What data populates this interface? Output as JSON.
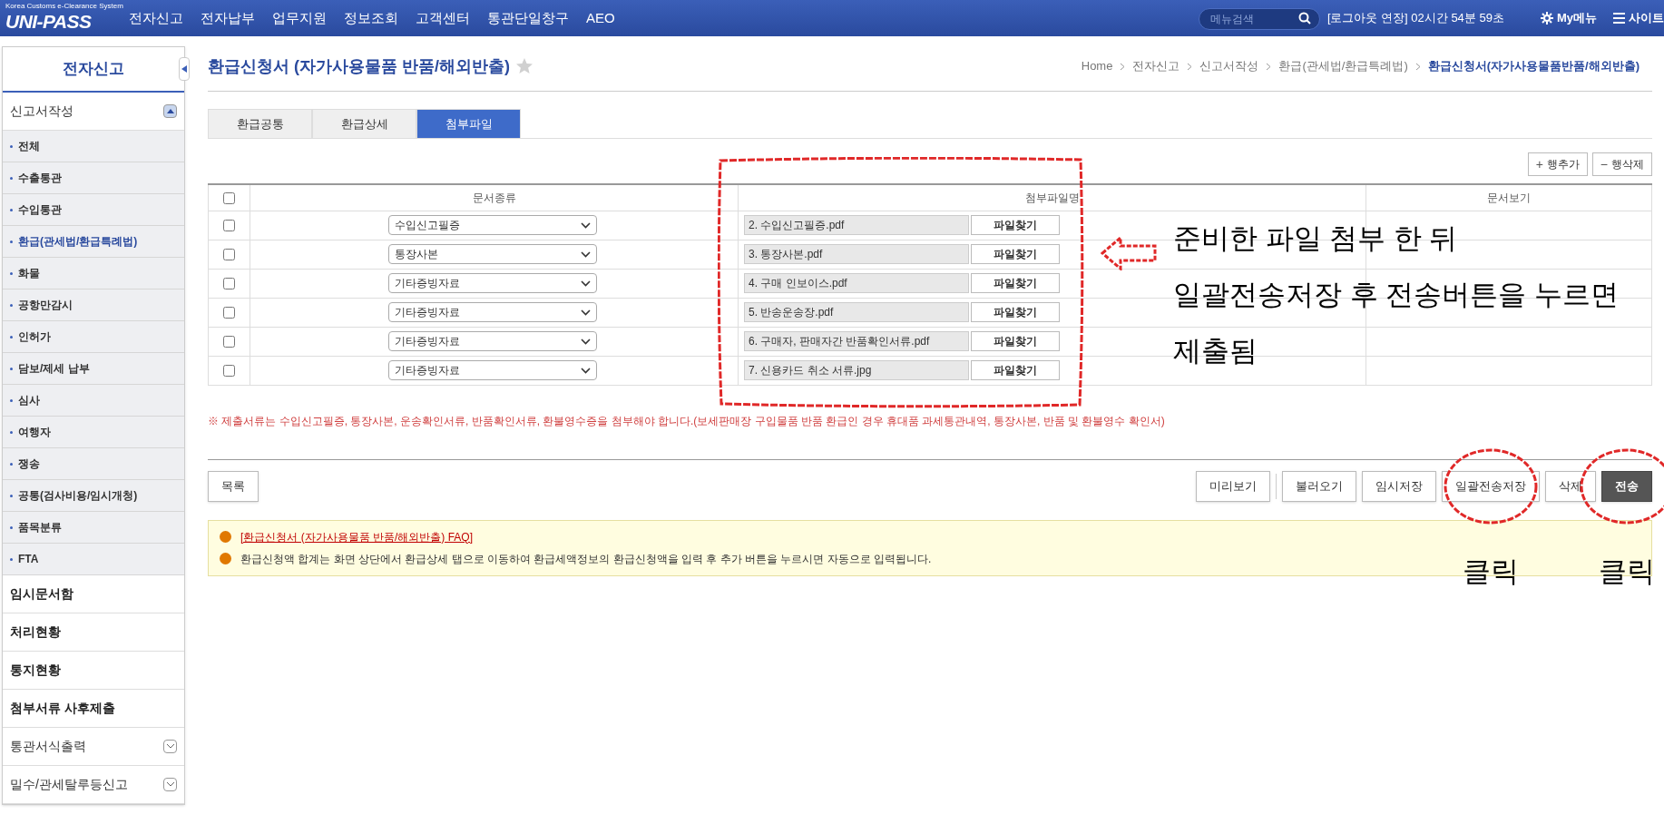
{
  "top_bar": {
    "logo": "UNI-PASS",
    "logo_subtitle": "Korea Customs e-Clearance System",
    "menu": [
      "전자신고",
      "전자납부",
      "업무지원",
      "정보조회",
      "고객센터",
      "통관단일창구",
      "AEO"
    ],
    "search": {
      "placeholder": "메뉴검색"
    },
    "session": "[로그아웃 연장] 02시간 54분 59초",
    "my_menu": "My메뉴",
    "sitemap": "사이트"
  },
  "sidebar": {
    "title": "전자신고",
    "items": [
      {
        "label": "신고서작성",
        "kind": "group",
        "expanded": true,
        "children": [
          {
            "label": "전체",
            "selected": false
          },
          {
            "label": "수출통관",
            "selected": false
          },
          {
            "label": "수입통관",
            "selected": false
          },
          {
            "label": "환급(관세법/환급특례법)",
            "selected": true
          },
          {
            "label": "화물",
            "selected": false
          },
          {
            "label": "공항만감시",
            "selected": false
          },
          {
            "label": "인허가",
            "selected": false
          },
          {
            "label": "담보/제세 납부",
            "selected": false
          },
          {
            "label": "심사",
            "selected": false
          },
          {
            "label": "여행자",
            "selected": false
          },
          {
            "label": "쟁송",
            "selected": false
          },
          {
            "label": "공통(검사비용/임시개청)",
            "selected": false
          },
          {
            "label": "품목분류",
            "selected": false
          },
          {
            "label": "FTA",
            "selected": false
          }
        ]
      },
      {
        "label": "임시문서함",
        "kind": "link"
      },
      {
        "label": "처리현황",
        "kind": "link"
      },
      {
        "label": "통지현황",
        "kind": "link"
      },
      {
        "label": "첨부서류 사후제출",
        "kind": "link"
      },
      {
        "label": "통관서식출력",
        "kind": "group",
        "expanded": false
      },
      {
        "label": "밀수/관세탈루등신고",
        "kind": "group",
        "expanded": false
      }
    ]
  },
  "page": {
    "title": "환급신청서 (자가사용물품 반품/해외반출)",
    "favorite": false,
    "breadcrumb": [
      "Home",
      "전자신고",
      "신고서작성",
      "환급(관세법/환급특례법)",
      "환급신청서(자가사용물품반품/해외반출)"
    ]
  },
  "tabs": [
    {
      "label": "환급공통",
      "selected": false
    },
    {
      "label": "환급상세",
      "selected": false
    },
    {
      "label": "첨부파일",
      "selected": true
    }
  ],
  "row_actions": [
    {
      "icon": "+",
      "label": "행추가"
    },
    {
      "icon": "−",
      "label": "행삭제"
    }
  ],
  "table": {
    "header_checked": false,
    "columns": [
      "문서종류",
      "첨부파일명",
      "문서보기"
    ],
    "rows": [
      {
        "checked": false,
        "doc_type": "수입신고필증",
        "file_name": "2. 수입신고필증.pdf",
        "button": "파일찾기"
      },
      {
        "checked": false,
        "doc_type": "통장사본",
        "file_name": "3. 통장사본.pdf",
        "button": "파일찾기"
      },
      {
        "checked": false,
        "doc_type": "기타증빙자료",
        "file_name": "4. 구매 인보이스.pdf",
        "button": "파일찾기"
      },
      {
        "checked": false,
        "doc_type": "기타증빙자료",
        "file_name": "5. 반송운송장.pdf",
        "button": "파일찾기"
      },
      {
        "checked": false,
        "doc_type": "기타증빙자료",
        "file_name": "6. 구매자, 판매자간 반품확인서류.pdf",
        "button": "파일찾기"
      },
      {
        "checked": false,
        "doc_type": "기타증빙자료",
        "file_name": "7. 신용카드 취소 서류.jpg",
        "button": "파일찾기"
      }
    ]
  },
  "notice": "※ 제출서류는 수입신고필증, 통장사본, 운송확인서류, 반품확인서류, 환불영수증을 첨부해야 합니다.(보세판매장 구입물품 반품 환급인 경우 휴대품 과세통관내역, 통장사본, 반품 및 환불영수 확인서)",
  "left_button": "목록",
  "buttons": [
    {
      "label": "미리보기",
      "kind": "normal",
      "circled": false
    },
    {
      "label": "불러오기",
      "kind": "normal",
      "circled": false
    },
    {
      "label": "임시저장",
      "kind": "normal",
      "circled": false
    },
    {
      "label": "일괄전송저장",
      "kind": "normal",
      "circled": true,
      "click_label": "클릭"
    },
    {
      "label": "삭제",
      "kind": "normal",
      "circled": false
    },
    {
      "label": "전송",
      "kind": "dark",
      "circled": true,
      "click_label": "클릭"
    }
  ],
  "info": [
    {
      "kind": "link",
      "text": "[환급신청서 (자가사용물품 반품/해외반출) FAQ]"
    },
    {
      "kind": "text",
      "text": "환급신청액 합계는 화면 상단에서 환급상세 탭으로 이동하여 환급세액정보의 환급신청액을 입력 후 추가 버튼을 누르시면 자동으로 입력됩니다."
    }
  ],
  "annotations": {
    "callout": [
      "준비한 파일 첨부 한 뒤",
      "일괄전송저장 후 전송버튼을 누르면",
      "제출됨"
    ]
  }
}
